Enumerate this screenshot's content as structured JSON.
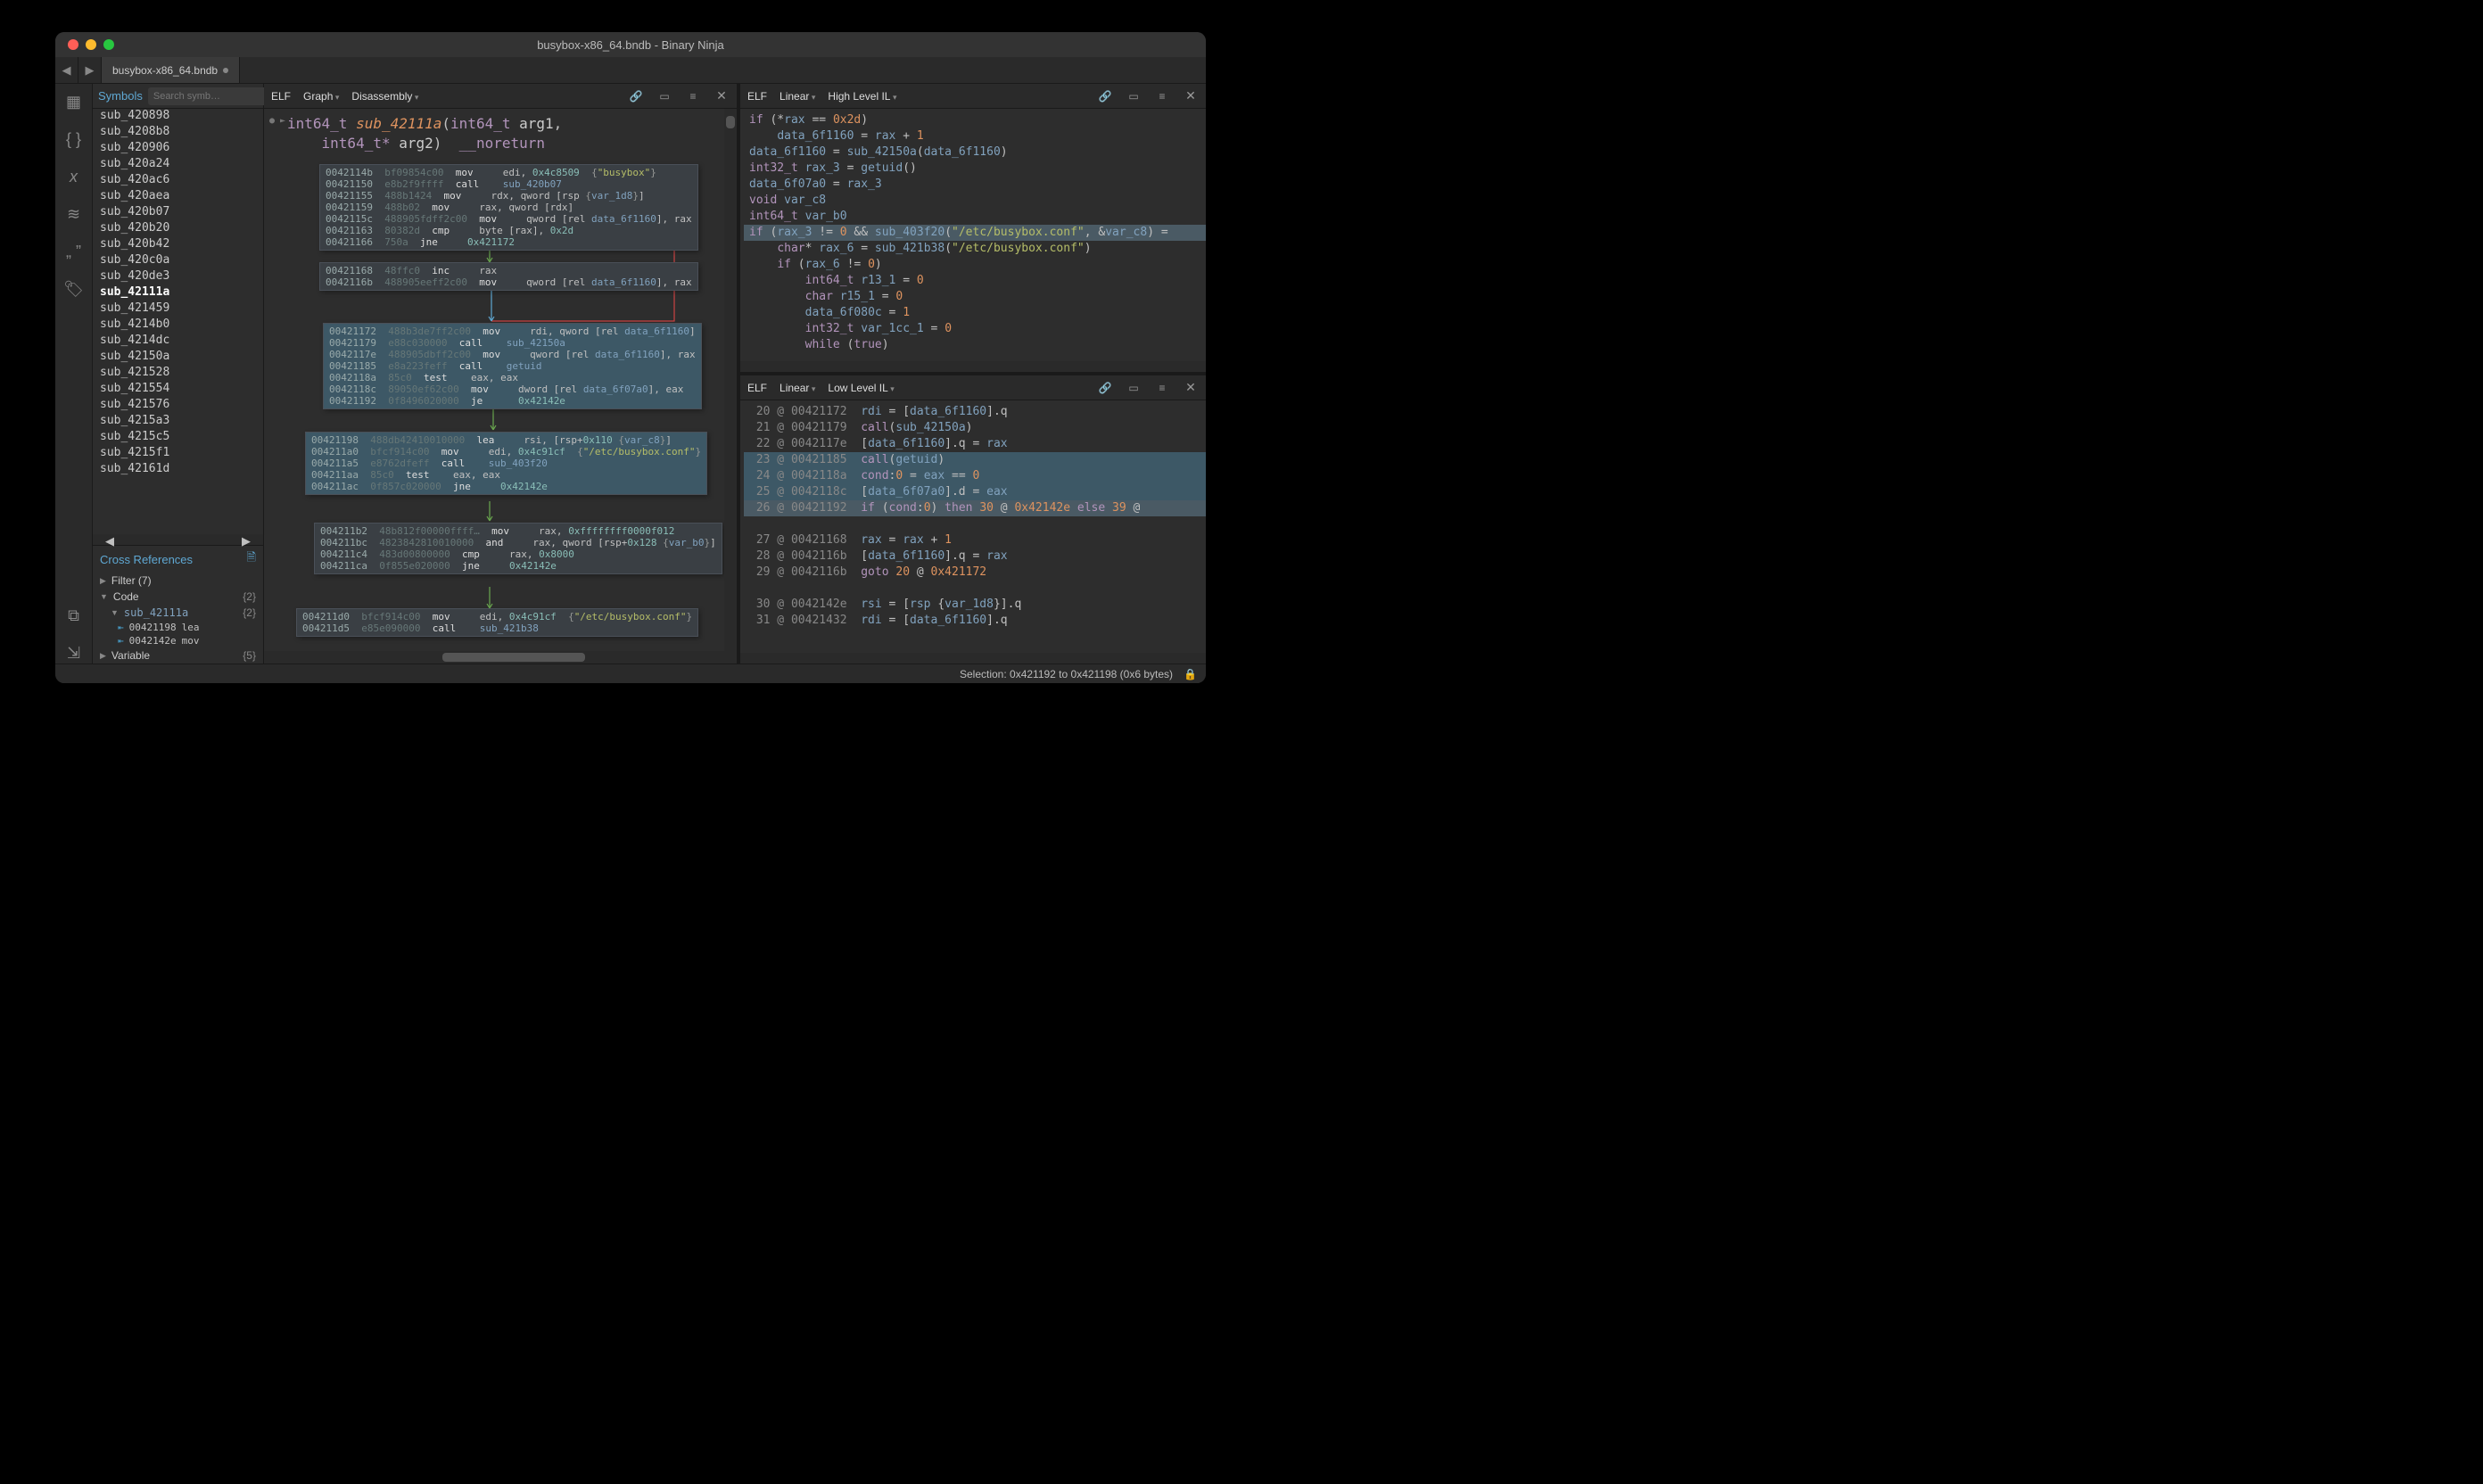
{
  "window_title": "busybox-x86_64.bndb - Binary Ninja",
  "tab_name": "busybox-x86_64.bndb",
  "sidebar": {
    "title": "Symbols",
    "search_placeholder": "Search symb…",
    "symbols": [
      "sub_420898",
      "sub_4208b8",
      "sub_420906",
      "sub_420a24",
      "sub_420ac6",
      "sub_420aea",
      "sub_420b07",
      "sub_420b20",
      "sub_420b42",
      "sub_420c0a",
      "sub_420de3",
      "sub_42111a",
      "sub_421459",
      "sub_4214b0",
      "sub_4214dc",
      "sub_42150a",
      "sub_421528",
      "sub_421554",
      "sub_421576",
      "sub_4215a3",
      "sub_4215c5",
      "sub_4215f1",
      "sub_42161d"
    ],
    "selected": "sub_42111a"
  },
  "xref": {
    "title": "Cross References",
    "filter_label": "Filter (7)",
    "sections": [
      {
        "label": "Code",
        "count": "{2}",
        "items": [
          {
            "name": "sub_42111a",
            "count": "{2}",
            "refs": [
              {
                "addr": "00421198",
                "op": "lea"
              },
              {
                "addr": "0042142e",
                "op": "mov"
              }
            ]
          }
        ]
      },
      {
        "label": "Variable",
        "count": "{5}"
      }
    ]
  },
  "views": {
    "graph": {
      "fmt": "ELF",
      "mode": "Graph",
      "il": "Disassembly"
    },
    "hlil": {
      "fmt": "ELF",
      "mode": "Linear",
      "il": "High Level IL"
    },
    "llil": {
      "fmt": "ELF",
      "mode": "Linear",
      "il": "Low Level IL"
    }
  },
  "fnsig": {
    "ret": "int64_t",
    "name": "sub_42111a",
    "a1t": "int64_t",
    "a1n": "arg1",
    "a2t": "int64_t*",
    "a2n": "arg2",
    "attr": "__noreturn"
  },
  "nodes": {
    "n1": [
      "0042114b  bf09854c00      mov     edi, 0x4c8509  {\"busybox\"}",
      "00421150  e8b2f9ffff      call    sub_420b07",
      "00421155  488b1424        mov     rdx, qword [rsp {var_1d8}]",
      "00421159  488b02          mov     rax, qword [rdx]",
      "0042115c  488905fdff2c00  mov     qword [rel data_6f1160], rax",
      "00421163  80382d          cmp     byte [rax], 0x2d",
      "00421166  750a            jne     0x421172"
    ],
    "n2": [
      "00421168  48ffc0          inc     rax",
      "0042116b  488905eeff2c00  mov     qword [rel data_6f1160], rax"
    ],
    "n3": [
      "00421172  488b3de7ff2c00  mov     rdi, qword [rel data_6f1160]",
      "00421179  e88c030000      call    sub_42150a",
      "0042117e  488905dbff2c00  mov     qword [rel data_6f1160], rax",
      "00421185  e8a223feff      call    getuid",
      "0042118a  85c0            test    eax, eax",
      "0042118c  89050ef62c00    mov     dword [rel data_6f07a0], eax",
      "00421192  0f8496020000    je      0x42142e"
    ],
    "n4": [
      "00421198  488db42410010000  lea     rsi, [rsp+0x110 {var_c8}]",
      "004211a0  bfcf914c00        mov     edi, 0x4c91cf  {\"/etc/busybox.conf\"}",
      "004211a5  e8762dfeff        call    sub_403f20",
      "004211aa  85c0              test    eax, eax",
      "004211ac  0f857c020000      jne     0x42142e"
    ],
    "n5": [
      "004211b2  48b812f00000ffff… mov     rax, 0xffffffff0000f012",
      "004211bc  4823842810010000  and     rax, qword [rsp+0x128 {var_b0}]",
      "004211c4  483d00800000      cmp     rax, 0x8000",
      "004211ca  0f855e020000      jne     0x42142e"
    ],
    "n6": [
      "004211d0  bfcf914c00      mov     edi, 0x4c91cf  {\"/etc/busybox.conf\"}",
      "004211d5  e85e090000      call    sub_421b38"
    ]
  },
  "hlil": [
    {
      "t": "if (*rax == 0x2d)"
    },
    {
      "t": "    data_6f1160 = rax + 1",
      "indent": 1
    },
    {
      "t": "data_6f1160 = sub_42150a(data_6f1160)"
    },
    {
      "t": "int32_t rax_3 = getuid()"
    },
    {
      "t": "data_6f07a0 = rax_3"
    },
    {
      "t": "void var_c8"
    },
    {
      "t": "int64_t var_b0"
    },
    {
      "t": "if (rax_3 != 0 && sub_403f20(\"/etc/busybox.conf\", &var_c8) =",
      "hl": true
    },
    {
      "t": "    char* rax_6 = sub_421b38(\"/etc/busybox.conf\")",
      "indent": 1
    },
    {
      "t": "    if (rax_6 != 0)",
      "indent": 1
    },
    {
      "t": "        int64_t r13_1 = 0",
      "indent": 2
    },
    {
      "t": "        char r15_1 = 0",
      "indent": 2
    },
    {
      "t": "        data_6f080c = 1",
      "indent": 2
    },
    {
      "t": "        int32_t var_1cc_1 = 0",
      "indent": 2
    },
    {
      "t": "        while (true)",
      "indent": 2
    }
  ],
  "llil": [
    {
      "n": "20",
      "a": "00421172",
      "t": "rdi = [data_6f1160].q"
    },
    {
      "n": "21",
      "a": "00421179",
      "t": "call(sub_42150a)"
    },
    {
      "n": "22",
      "a": "0042117e",
      "t": "[data_6f1160].q = rax"
    },
    {
      "n": "23",
      "a": "00421185",
      "t": "call(getuid)",
      "hl": true
    },
    {
      "n": "24",
      "a": "0042118a",
      "t": "cond:0 = eax == 0",
      "hl": true
    },
    {
      "n": "25",
      "a": "0042118c",
      "t": "[data_6f07a0].d = eax",
      "hl": true
    },
    {
      "n": "26",
      "a": "00421192",
      "t": "if (cond:0) then 30 @ 0x42142e else 39 @",
      "hl2": true
    },
    {
      "gap": true
    },
    {
      "n": "27",
      "a": "00421168",
      "t": "rax = rax + 1"
    },
    {
      "n": "28",
      "a": "0042116b",
      "t": "[data_6f1160].q = rax"
    },
    {
      "n": "29",
      "a": "0042116b",
      "t": "goto 20 @ 0x421172"
    },
    {
      "gap": true
    },
    {
      "n": "30",
      "a": "0042142e",
      "t": "rsi = [rsp {var_1d8}].q"
    },
    {
      "n": "31",
      "a": "00421432",
      "t": "rdi = [data_6f1160].q"
    }
  ],
  "status": "Selection: 0x421192 to 0x421198 (0x6 bytes)"
}
